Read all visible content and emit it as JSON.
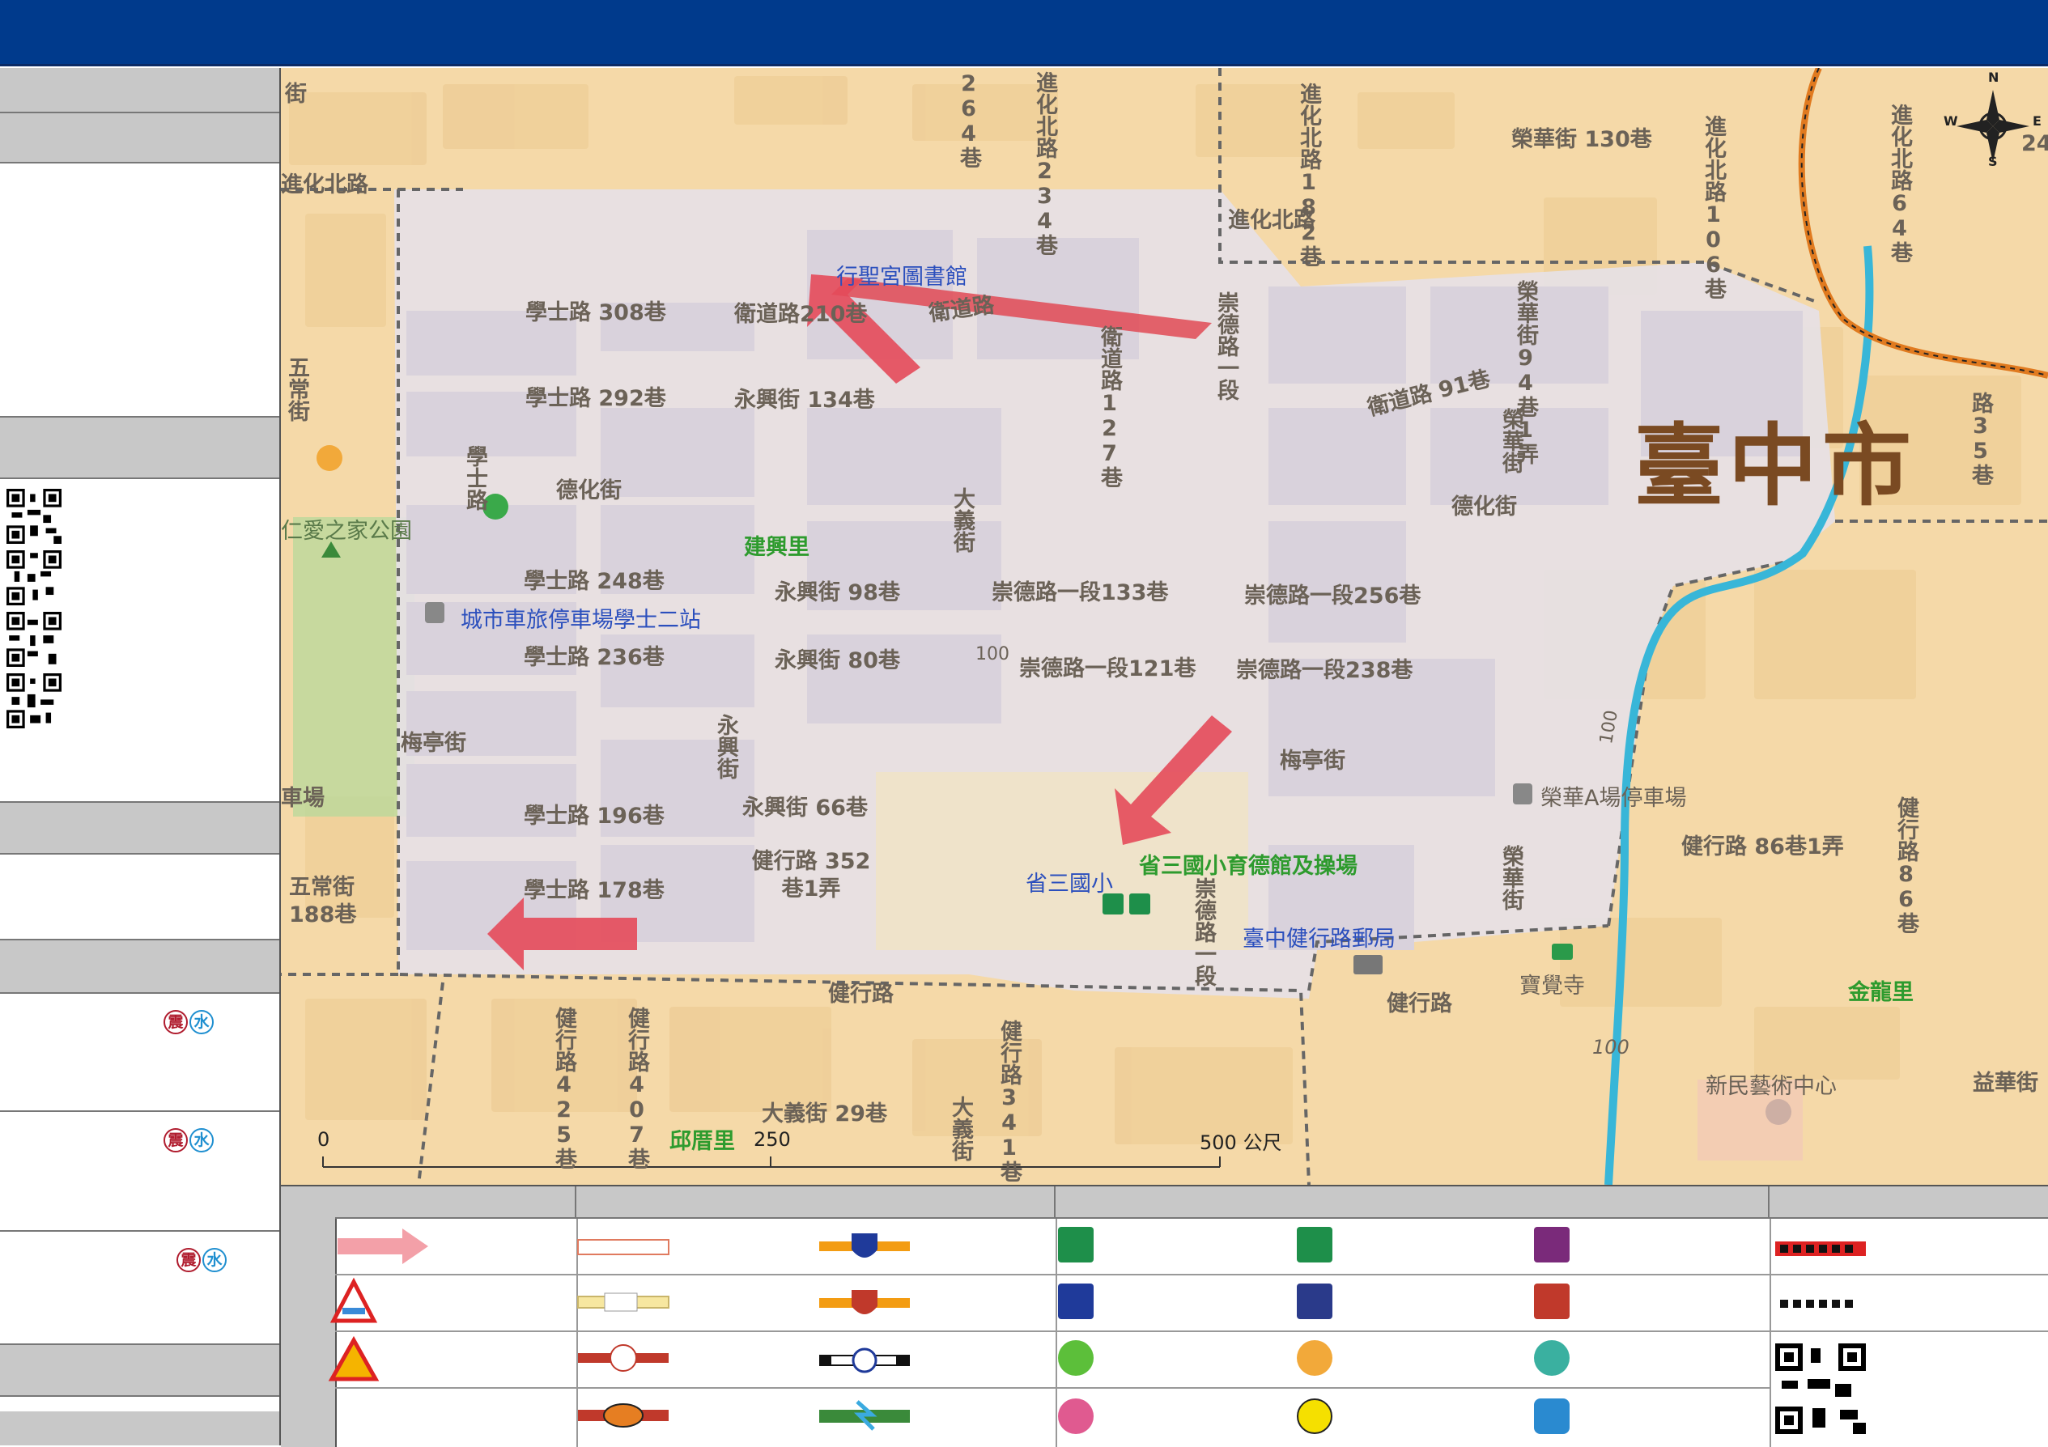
{
  "map": {
    "city_name": "臺中市",
    "compass": {
      "n": "N",
      "s": "S",
      "e": "E",
      "w": "W"
    },
    "scale": {
      "zero": "0",
      "mid": "250",
      "end": "500 公尺"
    },
    "streets": {
      "s1": "街",
      "s2": "264巷",
      "s3": "進化北路234巷",
      "s4": "進化北路182巷",
      "s5": "榮華街 130巷",
      "s6": "進化北路106巷",
      "s7": "進化北路64巷",
      "s8": "進化北路",
      "s9": "進化北路",
      "s10": "學士路 308巷",
      "s11": "衛道路210巷",
      "s12": "衛道路",
      "s13": "崇德路一段",
      "s14": "榮華街94巷1弄",
      "s15": "學士路 292巷",
      "s16": "永興街 134巷",
      "s17": "衛道路127巷",
      "s18": "衛道路 91巷",
      "s19": "榮華街",
      "s20": "五常街",
      "s21": "學士路",
      "s22": "德化街",
      "s23": "德化街",
      "s24": "學士路 248巷",
      "s25": "永興街 98巷",
      "s26": "大義街",
      "s27": "崇德路一段133巷",
      "s28": "崇德路一段256巷",
      "s29": "學士路 236巷",
      "s30": "永興街 80巷",
      "s31": "崇德路一段121巷",
      "s32": "崇德路一段238巷",
      "s33": "梅亭街",
      "s34": "永興街",
      "s35": "梅亭街",
      "s36": "學士路 196巷",
      "s37": "永興街 66巷",
      "s38": "健行路 86巷1弄",
      "s39": "健行路 352巷1弄",
      "s40": "學士路 178巷",
      "s41": "五常街 188巷",
      "s42": "崇德路一段",
      "s43": "健行路",
      "s44": "健行路",
      "s45": "健行路425巷",
      "s46": "健行路407巷",
      "s47": "健行路341巷",
      "s48": "大義街 29巷",
      "s49": "大義街",
      "s50": "健行路86巷",
      "s51": "路35巷",
      "s52": "益華街",
      "s53": "榮華街",
      "s54": "車場",
      "s55": "24",
      "s56": "100",
      "s57": "100",
      "s58": "100"
    },
    "pois": {
      "p1": "行聖宮圖書館",
      "p2": "建興里",
      "p3": "城市車旅停車場學士二站",
      "p4": "仁愛之家公園",
      "p5": "省三國小",
      "p6": "省三國小育德館及操場",
      "p7": "臺中健行路郵局",
      "p8": "榮華A場停車場",
      "p9": "寶覺寺",
      "p10": "金龍里",
      "p11": "新民藝術中心",
      "p12": "邱厝里"
    }
  },
  "sidebar": {
    "badges": [
      {
        "a": "震",
        "b": "水"
      },
      {
        "a": "震",
        "b": "水"
      },
      {
        "a": "震",
        "b": "水"
      }
    ]
  },
  "colors": {
    "topbar": "#003a8c",
    "region_fill": "#e6e1e6",
    "river": "#38b6d8",
    "boundary": "#e07a1f"
  }
}
